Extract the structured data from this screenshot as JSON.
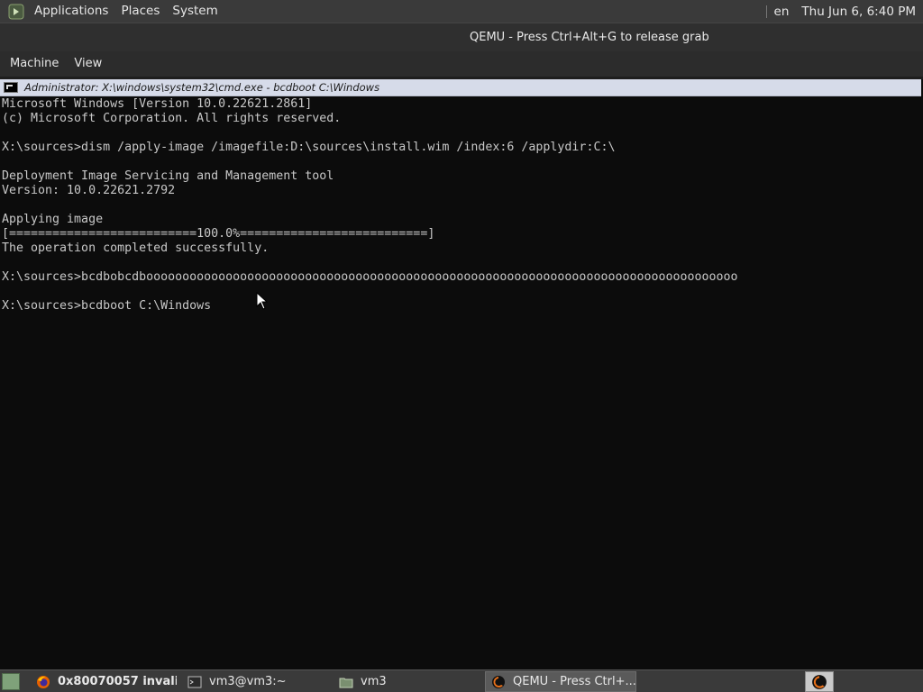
{
  "top_panel": {
    "menus": [
      "Applications",
      "Places",
      "System"
    ],
    "language": "en",
    "clock": "Thu Jun  6,  6:40 PM"
  },
  "qemu": {
    "window_title": "QEMU - Press Ctrl+Alt+G to release grab",
    "menubar": [
      "Machine",
      "View"
    ]
  },
  "cmd_window": {
    "title": "Administrator: X:\\windows\\system32\\cmd.exe - bcdboot  C:\\Windows",
    "lines": [
      "Microsoft Windows [Version 10.0.22621.2861]",
      "(c) Microsoft Corporation. All rights reserved.",
      "",
      "X:\\sources>dism /apply-image /imagefile:D:\\sources\\install.wim /index:6 /applydir:C:\\",
      "",
      "Deployment Image Servicing and Management tool",
      "Version: 10.0.22621.2792",
      "",
      "Applying image",
      "[==========================100.0%==========================]",
      "The operation completed successfully.",
      "",
      "X:\\sources>bcdbobcdboooooooooooooooooooooooooooooooooooooooooooooooooooooooooooooooooooooooooooooooooo",
      "",
      "X:\\sources>bcdboot C:\\Windows"
    ]
  },
  "taskbar": {
    "tasks": [
      {
        "label": "0x80070057 invali...",
        "icon": "firefox-icon",
        "active": false
      },
      {
        "label": "vm3@vm3:~",
        "icon": "terminal-icon",
        "active": false
      },
      {
        "label": "vm3",
        "icon": "folder-icon",
        "active": false
      },
      {
        "label": "QEMU - Press Ctrl+...",
        "icon": "qemu-icon",
        "active": true
      }
    ]
  },
  "colors": {
    "panel_bg": "#3a3a3a",
    "console_bg": "#0c0c0c",
    "console_fg": "#c8c8c8",
    "cmd_titlebar_bg": "#d6dbe9",
    "qemu_orange": "#e8701a"
  }
}
